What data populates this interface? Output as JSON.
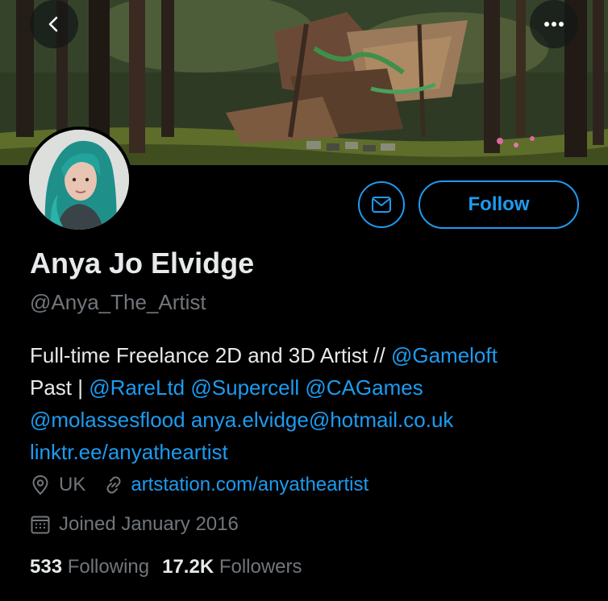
{
  "header": {
    "back_icon": "chevron-left-icon",
    "more_icon": "ellipsis-icon"
  },
  "profile": {
    "name": "Anya Jo Elvidge",
    "handle": "@Anya_The_Artist",
    "bio": {
      "line1_text": "Full-time Freelance 2D and 3D Artist // ",
      "line1_link": "@Gameloft",
      "line2_text": "Past | ",
      "line2_links": [
        "@RareLtd",
        "@Supercell",
        "@CAGames"
      ],
      "line3_links": [
        "@molassesflood",
        "anya.elvidge@hotmail.co.uk"
      ],
      "line4_link": "linktr.ee/anyatheartist"
    },
    "location": "UK",
    "website": "artstation.com/anyatheartist",
    "joined": "Joined January 2016",
    "following_count": "533",
    "following_label": "Following",
    "followers_count": "17.2K",
    "followers_label": "Followers"
  },
  "actions": {
    "follow_label": "Follow",
    "message_icon": "envelope-icon"
  },
  "colors": {
    "background": "#000000",
    "accent": "#1d9bf0",
    "primary_text": "#e7e9ea",
    "secondary_text": "#71767b"
  }
}
